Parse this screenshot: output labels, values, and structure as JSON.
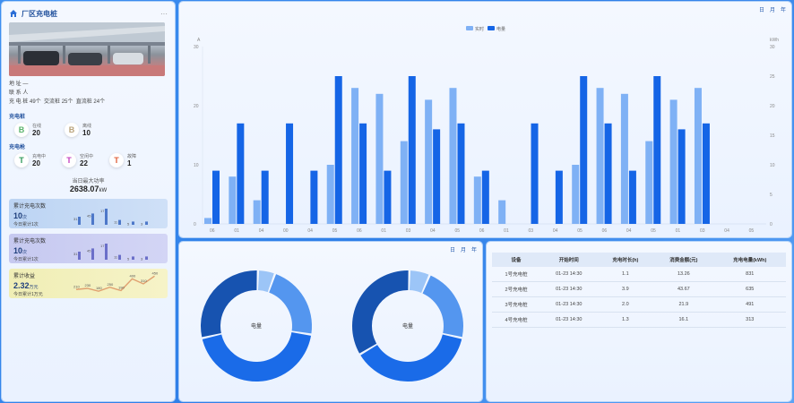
{
  "station": {
    "name": "厂区充电桩",
    "more": "···",
    "info_rows": [
      {
        "label": "地    址",
        "value": "—"
      },
      {
        "label": "联 系 人",
        "value": ""
      }
    ],
    "counts_line": {
      "label": "充 电 桩",
      "items": [
        "49个",
        "交流桩 25个",
        "直流桩 24个"
      ]
    }
  },
  "pile_section": {
    "title": "充电桩",
    "items": [
      {
        "icon": "B",
        "label": "在线",
        "value": "20",
        "color": "#59b36b"
      },
      {
        "icon": "B",
        "label": "离线",
        "value": "10",
        "color": "#b9a27a"
      }
    ]
  },
  "gun_section": {
    "title": "充电枪",
    "items": [
      {
        "icon": "T",
        "label": "充电中",
        "value": "20",
        "color": "#2f9a5a"
      },
      {
        "icon": "T",
        "label": "空闲中",
        "value": "22",
        "color": "#c33fbf"
      },
      {
        "icon": "T",
        "label": "故障",
        "value": "1",
        "color": "#e0603a"
      }
    ]
  },
  "energy": {
    "label": "当日最大功率",
    "value": "2638.07",
    "unit": "kW"
  },
  "cards": [
    {
      "title": "累计充电次数",
      "value": "10",
      "unit": "次",
      "sub": "今日累计1次",
      "bg": "linear-gradient(90deg,#bcd4f3,#cfe0f7)",
      "bar_color": "#4d78c9",
      "bars": [
        31,
        45,
        17,
        11,
        5,
        3
      ],
      "bar_labels": [
        "31",
        "45",
        "17",
        "11",
        "5",
        "3"
      ],
      "bar_heights": [
        0.5,
        0.7,
        1,
        0.3,
        0.2,
        0.2
      ]
    },
    {
      "title": "累计充电次数",
      "value": "10",
      "unit": "次",
      "sub": "今日累计1次",
      "bg": "linear-gradient(90deg,#c6c9f0,#d3d5f5)",
      "bar_color": "#6b6fc9",
      "bars": [
        31,
        45,
        17,
        11,
        5,
        3
      ],
      "bar_labels": [
        "31",
        "45",
        "17",
        "11",
        "5",
        "3"
      ],
      "bar_heights": [
        0.5,
        0.7,
        1,
        0.3,
        0.2,
        0.2
      ]
    },
    {
      "title": "累计收益",
      "value": "2.32",
      "unit": "万元",
      "sub": "今日累计1万元",
      "bg": "linear-gradient(90deg,#f0eeb5,#f6f3c8)",
      "line_color": "#e0a070",
      "points": [
        210,
        230,
        180,
        250,
        190,
        400,
        310,
        450
      ],
      "point_labels": [
        "210",
        "230",
        "180",
        "250",
        "190",
        "400",
        "310",
        "450"
      ]
    }
  ],
  "top_icons": [
    "日",
    "月",
    "年"
  ],
  "bar_chart": {
    "legend": [
      "实时",
      "电量"
    ],
    "y_left_ticks": [
      "30",
      "20",
      "10",
      "0"
    ],
    "y_right_ticks": [
      "30",
      "25",
      "20",
      "15",
      "10",
      "5",
      "0"
    ],
    "y_left_unit": "A",
    "y_right_unit": "kWh",
    "categories": [
      "06",
      "01",
      "04",
      "00",
      "04",
      "05",
      "06",
      "01",
      "03",
      "04",
      "05",
      "06",
      "01",
      "03",
      "04",
      "05",
      "06",
      "04",
      "05",
      "01",
      "03",
      "04",
      "05"
    ],
    "series_light_color": "#7fb1f5",
    "series_dark_color": "#1565e6"
  },
  "chart_data": {
    "type": "bar",
    "categories": [
      "06",
      "01",
      "04",
      "00",
      "04",
      "05",
      "06",
      "01",
      "03",
      "04",
      "05",
      "06",
      "01",
      "03",
      "04",
      "05",
      "06",
      "04",
      "05",
      "01",
      "03",
      "04",
      "05"
    ],
    "ylim": [
      0,
      30
    ],
    "series": [
      {
        "name": "实时",
        "values": [
          1,
          8,
          4,
          0,
          0,
          10,
          23,
          22,
          14,
          21,
          23,
          8,
          4,
          0,
          0,
          10,
          23,
          22,
          14,
          21,
          23,
          0,
          0
        ]
      },
      {
        "name": "电量",
        "values": [
          9,
          17,
          9,
          17,
          9,
          25,
          17,
          9,
          25,
          16,
          17,
          9,
          0,
          17,
          9,
          25,
          17,
          9,
          25,
          16,
          17,
          0,
          0
        ]
      }
    ]
  },
  "donuts": [
    {
      "center": "电量",
      "segments": [
        0.05,
        0.22,
        0.44,
        0.29
      ],
      "colors": [
        "#9cc5f7",
        "#5496ef",
        "#1a6be8",
        "#1753b0"
      ]
    },
    {
      "center": "电量",
      "segments": [
        0.06,
        0.22,
        0.38,
        0.34
      ],
      "colors": [
        "#9cc5f7",
        "#5496ef",
        "#1a6be8",
        "#1753b0"
      ]
    }
  ],
  "donut_icons": [
    "日",
    "月",
    "年"
  ],
  "table": {
    "headers": [
      "设备",
      "开始时间",
      "充电时长(h)",
      "消费金额(元)",
      "充电电量(kWh)"
    ],
    "rows": [
      [
        "1号充电桩",
        "01-23 14:30",
        "1.1",
        "13.26",
        "831"
      ],
      [
        "2号充电桩",
        "01-23 14:30",
        "3.9",
        "43.67",
        "635"
      ],
      [
        "3号充电桩",
        "01-23 14:30",
        "2.0",
        "21.9",
        "491"
      ],
      [
        "4号充电桩",
        "01-23 14:30",
        "1.3",
        "16.1",
        "313"
      ]
    ]
  }
}
